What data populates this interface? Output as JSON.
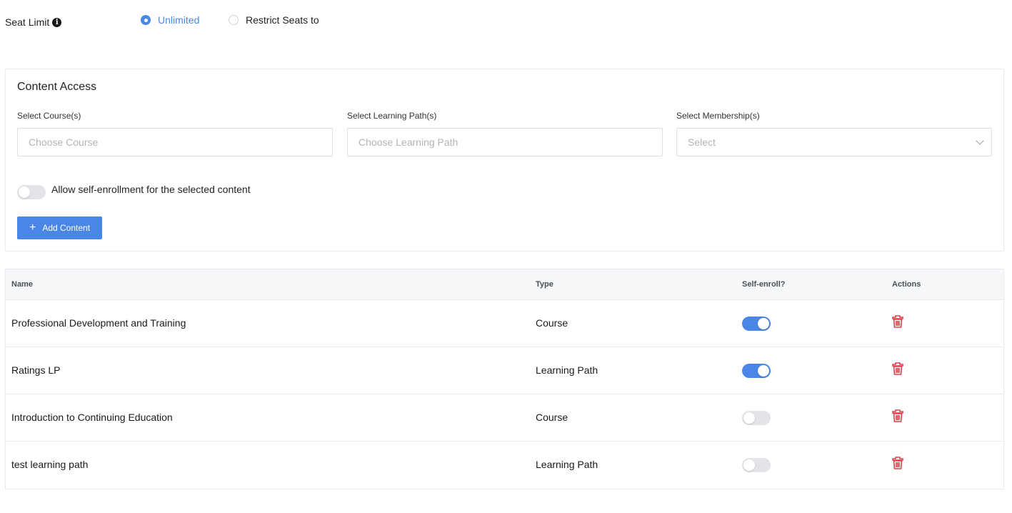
{
  "seat_limit": {
    "label": "Seat Limit",
    "info_icon": "info-icon",
    "options": [
      {
        "label": "Unlimited",
        "checked": true
      },
      {
        "label": "Restrict Seats to",
        "checked": false
      }
    ]
  },
  "content_access": {
    "title": "Content Access",
    "course": {
      "label": "Select Course(s)",
      "placeholder": "Choose Course"
    },
    "learning_path": {
      "label": "Select Learning Path(s)",
      "placeholder": "Choose Learning Path"
    },
    "membership": {
      "label": "Select Membership(s)",
      "placeholder": "Select"
    },
    "self_enroll_label": "Allow self-enrollment for the selected content",
    "self_enroll_on": false,
    "add_button": "Add Content"
  },
  "table": {
    "headers": {
      "name": "Name",
      "type": "Type",
      "self_enroll": "Self-enroll?",
      "actions": "Actions"
    },
    "rows": [
      {
        "name": "Professional Development and Training",
        "type": "Course",
        "self_enroll": true
      },
      {
        "name": "Ratings LP",
        "type": "Learning Path",
        "self_enroll": true
      },
      {
        "name": "Introduction to Continuing Education",
        "type": "Course",
        "self_enroll": false
      },
      {
        "name": "test learning path",
        "type": "Learning Path",
        "self_enroll": false
      }
    ]
  },
  "colors": {
    "accent": "#4a86e8",
    "danger": "#e0404a"
  }
}
